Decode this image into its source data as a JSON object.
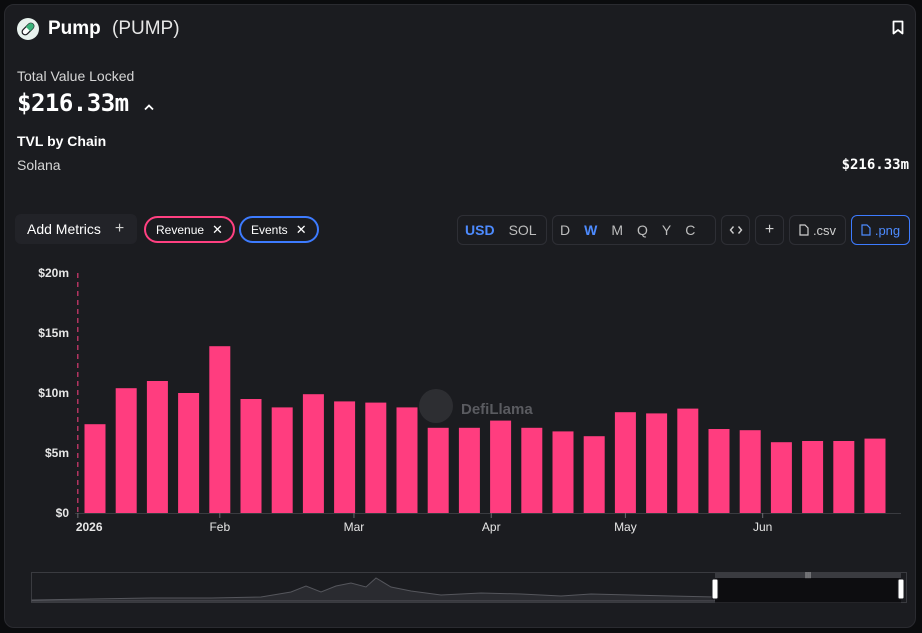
{
  "header": {
    "name": "Pump",
    "ticker": "(PUMP)",
    "logo_icon": "pill-icon",
    "bookmark_icon": "bookmark-icon"
  },
  "tvl": {
    "label": "Total Value Locked",
    "value": "$216.33m"
  },
  "chains": {
    "title": "TVL by Chain",
    "rows": [
      {
        "name": "Solana",
        "value": "$216.33m"
      }
    ]
  },
  "toolbar": {
    "add_metrics": "Add Metrics",
    "pills": [
      {
        "label": "Revenue",
        "color": "#ff4081"
      },
      {
        "label": "Events",
        "color": "#3d7bff"
      }
    ],
    "currency": [
      "USD",
      "SOL"
    ],
    "currency_selected": "USD",
    "periods": [
      "D",
      "W",
      "M",
      "Q",
      "Y",
      "C"
    ],
    "period_selected": "W",
    "embed_icon": "code-icon",
    "add_icon": "plus-icon",
    "csv": ".csv",
    "png": ".png"
  },
  "watermark": "DefiLlama",
  "chart_data": {
    "type": "bar",
    "series": [
      {
        "name": "Revenue",
        "color": "#ff3d7f",
        "values": [
          7.4,
          10.4,
          11.0,
          10.0,
          13.9,
          9.5,
          8.8,
          9.9,
          9.3,
          9.2,
          8.8,
          7.1,
          7.1,
          7.7,
          7.1,
          6.8,
          6.4,
          8.4,
          8.3,
          8.7,
          7.0,
          6.9,
          5.9,
          6.0,
          6.0,
          6.2
        ]
      }
    ],
    "ylim": [
      0,
      20
    ],
    "yticks": [
      {
        "v": 0,
        "label": "$0"
      },
      {
        "v": 5,
        "label": "$5m"
      },
      {
        "v": 10,
        "label": "$10m"
      },
      {
        "v": 15,
        "label": "$15m"
      },
      {
        "v": 20,
        "label": "$20m"
      }
    ],
    "xticks": [
      {
        "i": -0.55,
        "label": "2026",
        "bold": true
      },
      {
        "i": 4,
        "label": "Feb"
      },
      {
        "i": 8.3,
        "label": "Mar"
      },
      {
        "i": 12.7,
        "label": "Apr"
      },
      {
        "i": 17,
        "label": "May"
      },
      {
        "i": 21.4,
        "label": "Jun"
      }
    ],
    "event_marker_index": -0.55,
    "grid": false,
    "legend": "none"
  }
}
